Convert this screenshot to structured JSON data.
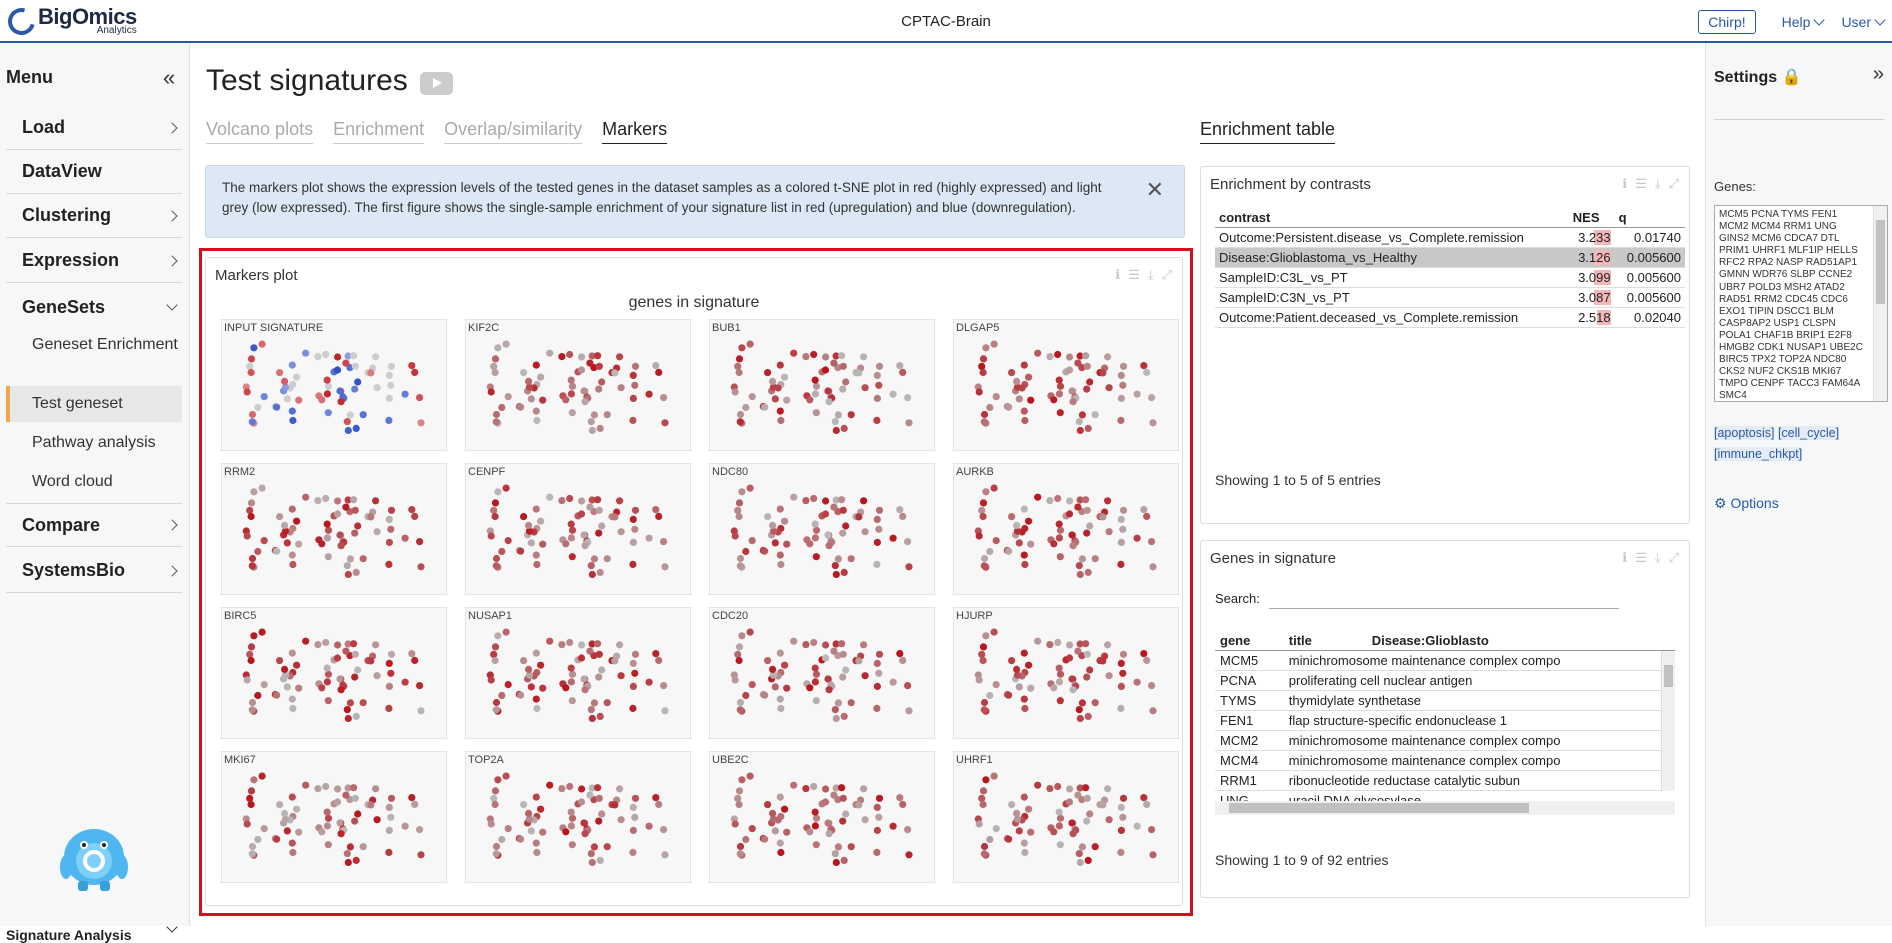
{
  "app": {
    "brand": "BigOmics",
    "brand_sub": "Analytics",
    "dataset_title": "CPTAC-Brain"
  },
  "topnav": {
    "chirp": "Chirp!",
    "help": "Help",
    "user": "User"
  },
  "sidebar": {
    "title": "Menu",
    "collapse": "«",
    "items": [
      {
        "label": "Load",
        "chevron": "right"
      },
      {
        "label": "DataView",
        "chevron": "none"
      },
      {
        "label": "Clustering",
        "chevron": "right"
      },
      {
        "label": "Expression",
        "chevron": "right"
      },
      {
        "label": "GeneSets",
        "chevron": "down"
      },
      {
        "label": "Compare",
        "chevron": "right"
      },
      {
        "label": "SystemsBio",
        "chevron": "right"
      }
    ],
    "subitems": [
      "Geneset Enrichment",
      "Test geneset",
      "Pathway analysis",
      "Word cloud"
    ],
    "active_subitem": "Test geneset",
    "bottom_label": "Signature Analysis"
  },
  "page": {
    "title": "Test signatures",
    "tabs": [
      "Volcano plots",
      "Enrichment",
      "Overlap/similarity",
      "Markers"
    ],
    "active_tab": "Markers",
    "right_tab": "Enrichment table",
    "info_text": "The markers plot shows the expression levels of the tested genes in the dataset samples as a colored t-SNE plot in red (highly expressed) and light grey (low expressed). The first figure shows the single-sample enrichment of your signature list in red (upregulation) and blue (downregulation)."
  },
  "markers": {
    "card_title": "Markers plot",
    "subtitle": "genes in signature",
    "panels": [
      "INPUT SIGNATURE",
      "KIF2C",
      "BUB1",
      "DLGAP5",
      "RRM2",
      "CENPF",
      "NDC80",
      "AURKB",
      "BIRC5",
      "NUSAP1",
      "CDC20",
      "HJURP",
      "MKI67",
      "TOP2A",
      "UBE2C",
      "UHRF1"
    ]
  },
  "enrichment": {
    "card_title": "Enrichment by contrasts",
    "columns": [
      "contrast",
      "NES",
      "q"
    ],
    "rows": [
      {
        "contrast": "Outcome:Persistent.disease_vs_Complete.remission",
        "nes": "3.233",
        "nes_value": 3.233,
        "q": "0.01740"
      },
      {
        "contrast": "Disease:Glioblastoma_vs_Healthy",
        "nes": "3.126",
        "nes_value": 3.126,
        "q": "0.005600"
      },
      {
        "contrast": "SampleID:C3L_vs_PT",
        "nes": "3.099",
        "nes_value": 3.099,
        "q": "0.005600"
      },
      {
        "contrast": "SampleID:C3N_vs_PT",
        "nes": "3.087",
        "nes_value": 3.087,
        "q": "0.005600"
      },
      {
        "contrast": "Outcome:Patient.deceased_vs_Complete.remission",
        "nes": "2.518",
        "nes_value": 2.518,
        "q": "0.02040"
      }
    ],
    "selected_row": 1,
    "showing": "Showing 1 to 5 of 5 entries"
  },
  "genes_table": {
    "card_title": "Genes in signature",
    "search_label": "Search:",
    "search_value": "",
    "columns": [
      "gene",
      "title",
      "Disease:Glioblasto"
    ],
    "rows": [
      {
        "gene": "MCM5",
        "title": "minichromosome maintenance complex compo"
      },
      {
        "gene": "PCNA",
        "title": "proliferating cell nuclear antigen"
      },
      {
        "gene": "TYMS",
        "title": "thymidylate synthetase"
      },
      {
        "gene": "FEN1",
        "title": "flap structure-specific endonuclease 1"
      },
      {
        "gene": "MCM2",
        "title": "minichromosome maintenance complex compo"
      },
      {
        "gene": "MCM4",
        "title": "minichromosome maintenance complex compo"
      },
      {
        "gene": "RRM1",
        "title": "ribonucleotide reductase catalytic subun"
      },
      {
        "gene": "UNG",
        "title": "uracil DNA glycosylase"
      }
    ],
    "showing": "Showing 1 to 9 of 92 entries"
  },
  "settings": {
    "title": "Settings",
    "genes_label": "Genes:",
    "genes_value": "MCM5 PCNA TYMS FEN1 MCM2 MCM4 RRM1 UNG GINS2 MCM6 CDCA7 DTL PRIM1 UHRF1 MLF1IP HELLS RFC2 RPA2 NASP RAD51AP1 GMNN WDR76 SLBP CCNE2 UBR7 POLD3 MSH2 ATAD2 RAD51 RRM2 CDC45 CDC6 EXO1 TIPIN DSCC1 BLM CASP8AP2 USP1 CLSPN POLA1 CHAF1B BRIP1 E2F8 HMGB2 CDK1 NUSAP1 UBE2C BIRC5 TPX2 TOP2A NDC80 CKS2 NUF2 CKS1B MKI67 TMPO CENPF TACC3 FAM64A SMC4",
    "tags": [
      "[apoptosis]",
      "[cell_cycle]",
      "[immune_chkpt]"
    ],
    "options": "Options"
  },
  "colors": {
    "brand": "#2b58a8",
    "highlight": "#d2121a",
    "high_expr": "#b8141c",
    "low_expr": "#b8b8b8",
    "down": "#2d4fc4"
  }
}
